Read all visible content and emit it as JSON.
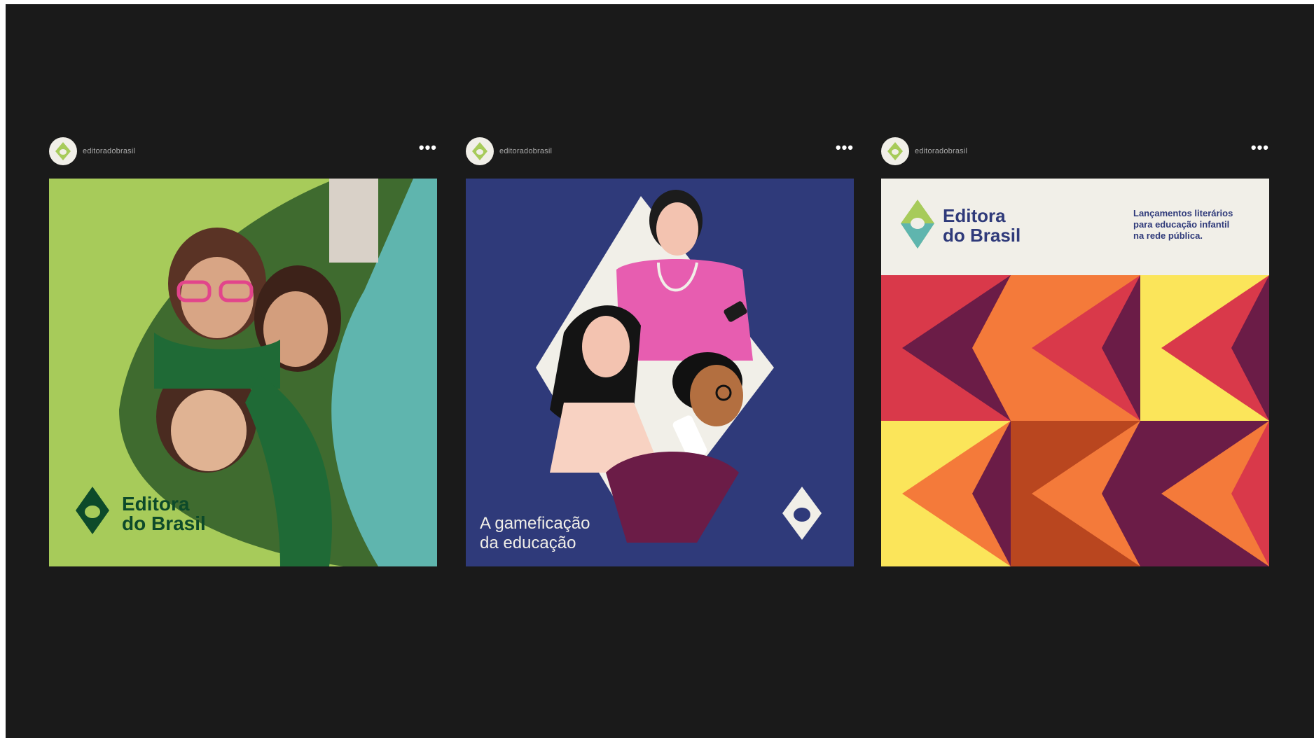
{
  "posts": [
    {
      "username": "editoradobrasil",
      "more_label": "•••",
      "logo_line1": "Editora",
      "logo_line2": "do Brasil"
    },
    {
      "username": "editoradobrasil",
      "more_label": "•••",
      "caption_line1": "A gameficação",
      "caption_line2": "da educação"
    },
    {
      "username": "editoradobrasil",
      "more_label": "•••",
      "logo_line1": "Editora",
      "logo_line2": "do Brasil",
      "tagline_line1": "Lançamentos literários",
      "tagline_line2": "para educação infantil",
      "tagline_line3": "na rede pública."
    }
  ],
  "colors": {
    "background": "#1a1a1a",
    "brand_green": "#a7cb5a",
    "brand_dark_green": "#0d4a2a",
    "brand_teal": "#5fb5ae",
    "navy": "#2f3a7a",
    "cream": "#f1efe8"
  }
}
